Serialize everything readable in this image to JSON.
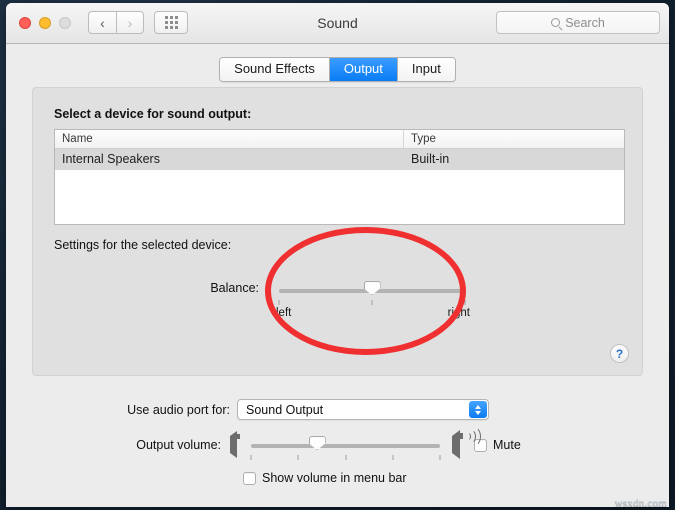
{
  "window": {
    "title": "Sound",
    "traffic_lights": {
      "close": "close-button",
      "minimize": "minimize-button",
      "zoom": "zoom-button"
    },
    "nav": {
      "back": "‹",
      "forward": "›"
    },
    "grid_button": "show-all-icon"
  },
  "search": {
    "placeholder": "Search",
    "icon": "search-icon"
  },
  "tabs": [
    {
      "label": "Sound Effects",
      "active": false
    },
    {
      "label": "Output",
      "active": true
    },
    {
      "label": "Input",
      "active": false
    }
  ],
  "panel": {
    "heading": "Select a device for sound output:",
    "table": {
      "columns": [
        "Name",
        "Type"
      ],
      "rows": [
        {
          "name": "Internal Speakers",
          "type": "Built-in",
          "selected": true
        }
      ]
    },
    "settings_heading": "Settings for the selected device:",
    "balance": {
      "label": "Balance:",
      "value_percent": 50,
      "left_label": "left",
      "right_label": "right",
      "tick_count": 3
    },
    "help_button": "?"
  },
  "bottom": {
    "port_label": "Use audio port for:",
    "port_value": "Sound Output",
    "port_options": [
      "Sound Output"
    ],
    "volume_label": "Output volume:",
    "volume_percent": 35,
    "volume_tick_count": 5,
    "speaker_low_icon": "speaker-low-icon",
    "speaker_high_icon": "speaker-high-icon",
    "mute_label": "Mute",
    "mute_checked": false,
    "menubar_label": "Show volume in menu bar",
    "menubar_checked": false
  },
  "annotation": {
    "shape": "ellipse",
    "color": "#f03030",
    "target": "balance-slider"
  },
  "watermark": "wsxdn.com"
}
